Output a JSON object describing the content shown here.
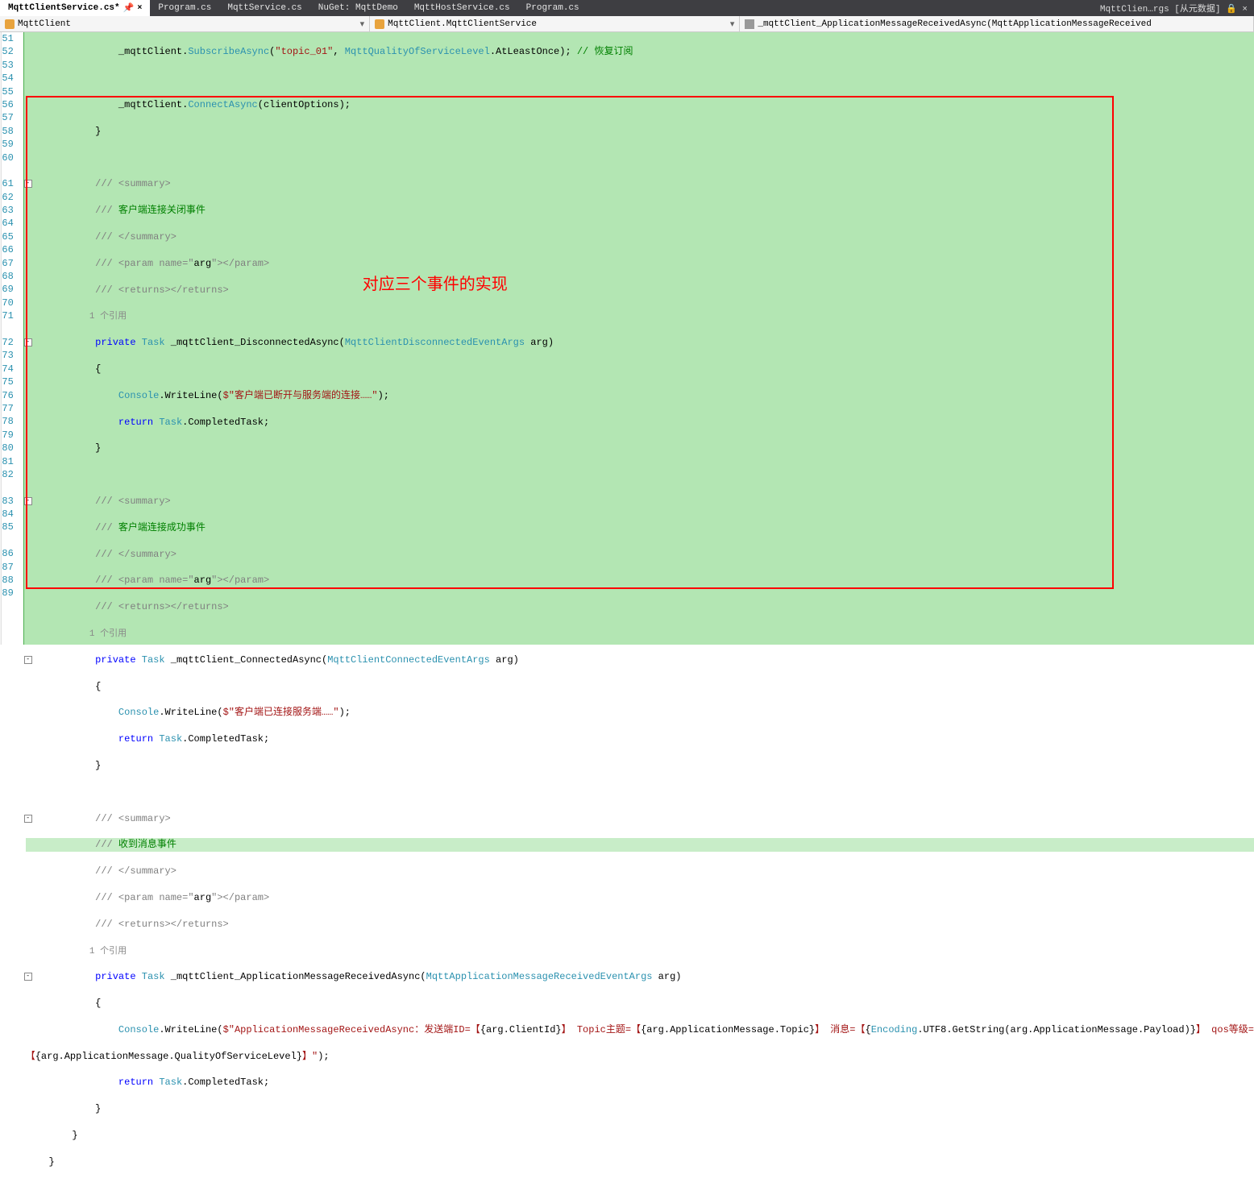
{
  "tabs": [
    {
      "label": "MqttClientService.cs*",
      "active": true,
      "close": "×"
    },
    {
      "label": "Program.cs",
      "active": false
    },
    {
      "label": "MqttService.cs",
      "active": false
    },
    {
      "label": "NuGet: MqttDemo",
      "active": false
    },
    {
      "label": "MqttHostService.cs",
      "active": false
    },
    {
      "label": "Program.cs",
      "active": false
    }
  ],
  "tab_right": "MqttClien…rgs [从元数据] 🔒  ×",
  "nav1": "MqttClient",
  "nav2": "MqttClient.MqttClientService",
  "nav3": "_mqttClient_ApplicationMessageReceivedAsync(MqttApplicationMessageReceived",
  "lines": {
    "50": "51",
    "51": "52",
    "52": "53",
    "53": "54",
    "54": "55",
    "55": "56",
    "56": "57",
    "57": "58",
    "58": "59",
    "59": "60",
    "60r": "1 个引用",
    "61": "61",
    "62": "62",
    "63": "63",
    "64": "64",
    "65": "65",
    "66": "66",
    "67": "67",
    "68": "68",
    "69": "69",
    "70": "70",
    "71": "71",
    "71r": "1 个引用",
    "72": "72",
    "73": "73",
    "74": "74",
    "75": "75",
    "76": "76",
    "77": "77",
    "78": "78",
    "79": "79",
    "80": "80",
    "81": "81",
    "82": "82",
    "82r": "1 个引用",
    "83": "83",
    "84": "84",
    "85": "85",
    "85b": "",
    "86": "86",
    "87": "87",
    "88": "88",
    "89": "89"
  },
  "code": {
    "l50a": "                _mqttClient.",
    "l50b": "SubscribeAsync",
    "l50c": "(",
    "l50s": "\"topic_01\"",
    "l50d": ", ",
    "l50t": "MqttQualityOfServiceLevel",
    "l50e": ".AtLeastOnce); ",
    "l50f": "// 恢复订阅",
    "l51": "",
    "l52a": "                _mqttClient.",
    "l52b": "ConnectAsync",
    "l52c": "(clientOptions);",
    "l53": "            }",
    "l54": "",
    "l55a": "            /// ",
    "l55b": "<summary>",
    "l56a": "            /// ",
    "l56b": "客户端连接关闭事件",
    "l57a": "            /// ",
    "l57b": "</summary>",
    "l58a": "            /// ",
    "l58b": "<param name=\"",
    "l58c": "arg",
    "l58d": "\"></param>",
    "l59a": "            /// ",
    "l59b": "<returns></returns>",
    "l60r": "            1 个引用",
    "l61a": "            ",
    "l61b": "private",
    "l61c": " ",
    "l61d": "Task",
    "l61e": " _mqttClient_DisconnectedAsync(",
    "l61f": "MqttClientDisconnectedEventArgs",
    "l61g": " arg)",
    "l62": "            {",
    "l63a": "                ",
    "l63b": "Console",
    "l63c": ".WriteLine(",
    "l63d": "$\"客户端已断开与服务端的连接……\"",
    "l63e": ");",
    "l64a": "                ",
    "l64b": "return",
    "l64c": " ",
    "l64d": "Task",
    "l64e": ".CompletedTask;",
    "l65": "            }",
    "l66": "",
    "l67a": "            /// ",
    "l67b": "<summary>",
    "l68a": "            /// ",
    "l68b": "客户端连接成功事件",
    "l69a": "            /// ",
    "l69b": "</summary>",
    "l70a": "            /// ",
    "l70b": "<param name=\"",
    "l70c": "arg",
    "l70d": "\"></param>",
    "l71a": "            /// ",
    "l71b": "<returns></returns>",
    "l71r": "            1 个引用",
    "l72a": "            ",
    "l72b": "private",
    "l72c": " ",
    "l72d": "Task",
    "l72e": " _mqttClient_ConnectedAsync(",
    "l72f": "MqttClientConnectedEventArgs",
    "l72g": " arg)",
    "l73": "            {",
    "l74a": "                ",
    "l74b": "Console",
    "l74c": ".WriteLine(",
    "l74d": "$\"客户端已连接服务端……\"",
    "l74e": ");",
    "l75a": "                ",
    "l75b": "return",
    "l75c": " ",
    "l75d": "Task",
    "l75e": ".CompletedTask;",
    "l76": "            }",
    "l77": "",
    "l78a": "            /// ",
    "l78b": "<summary>",
    "l79a": "            /// ",
    "l79b": "收到消息事件",
    "l80a": "            /// ",
    "l80b": "</summary>",
    "l81a": "            /// ",
    "l81b": "<param name=\"",
    "l81c": "arg",
    "l81d": "\"></param>",
    "l82a": "            /// ",
    "l82b": "<returns></returns>",
    "l82r": "            1 个引用",
    "l83a": "            ",
    "l83b": "private",
    "l83c": " ",
    "l83d": "Task",
    "l83e": " _mqttClient_ApplicationMessageReceivedAsync(",
    "l83f": "MqttApplicationMessageReceivedEventArgs",
    "l83g": " arg)",
    "l84": "            {",
    "l85a": "                ",
    "l85b": "Console",
    "l85c": ".WriteLine(",
    "l85d": "$\"ApplicationMessageReceivedAsync：发送端ID=【",
    "l85e": "{arg.ClientId}",
    "l85f": "】 Topic主题=【",
    "l85g": "{arg.ApplicationMessage.Topic}",
    "l85h": "】 消息=【",
    "l85i": "{",
    "l85j": "Encoding",
    "l85k": ".UTF8.GetString(arg.ApplicationMessage.Payload)}",
    "l85l": "】 qos等级=",
    "l85ba": "【",
    "l85bb": "{arg.ApplicationMessage.QualityOfServiceLevel}",
    "l85bc": "】\"",
    "l85bd": ");",
    "l86a": "                ",
    "l86b": "return",
    "l86c": " ",
    "l86d": "Task",
    "l86e": ".CompletedTask;",
    "l87": "            }",
    "l88": "        }",
    "l89": "    }"
  },
  "annotation": "对应三个事件的实现"
}
